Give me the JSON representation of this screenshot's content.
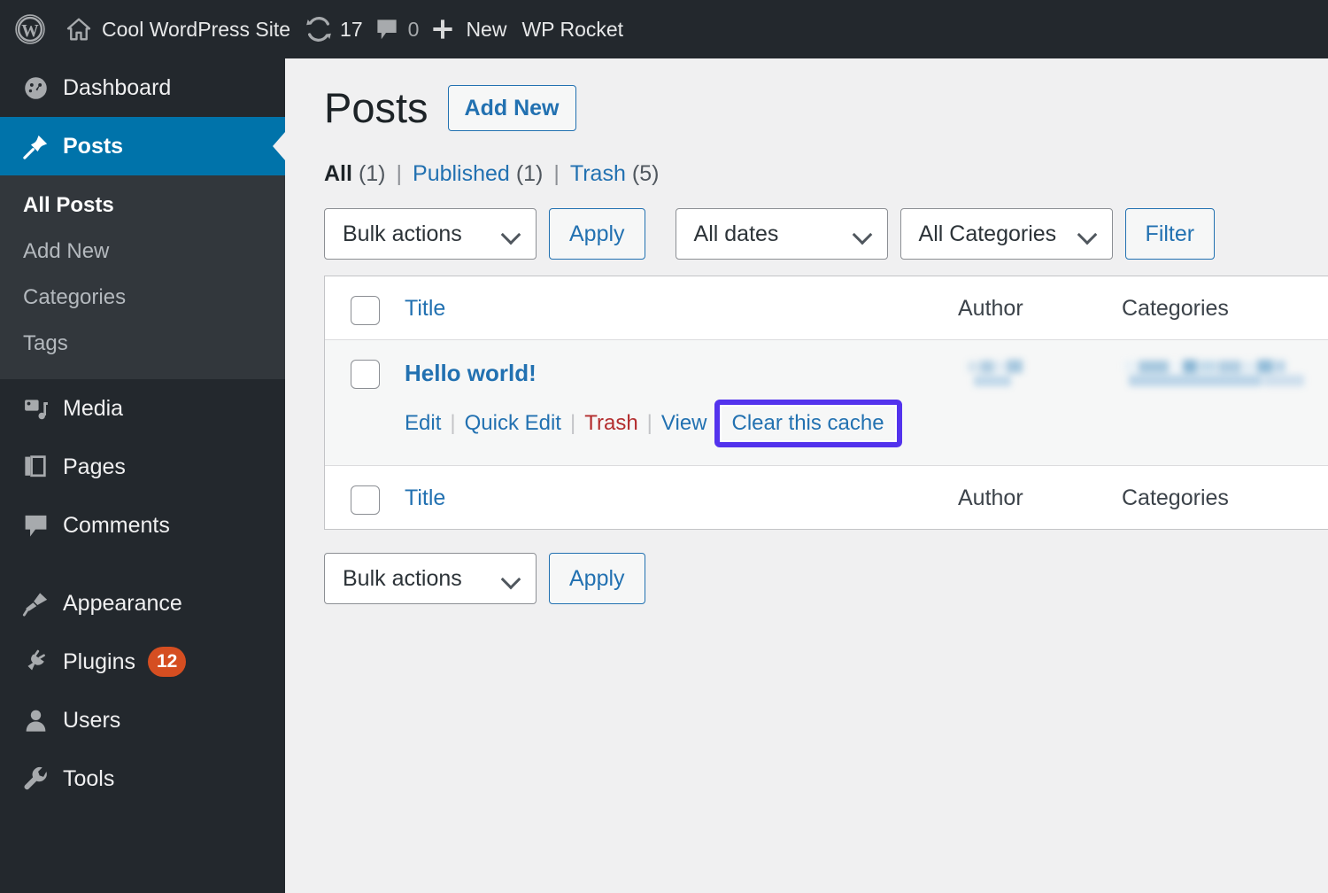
{
  "adminbar": {
    "wp_logo": "wordpress-logo",
    "site_name": "Cool WordPress Site",
    "updates_count": "17",
    "comments_count": "0",
    "new_label": "New",
    "wp_rocket_label": "WP Rocket"
  },
  "sidebar": {
    "items": [
      {
        "label": "Dashboard",
        "icon": "dashboard-icon",
        "current": false
      },
      {
        "label": "Posts",
        "icon": "pin-icon",
        "current": true
      },
      {
        "label": "Media",
        "icon": "media-icon",
        "current": false
      },
      {
        "label": "Pages",
        "icon": "pages-icon",
        "current": false
      },
      {
        "label": "Comments",
        "icon": "comments-icon",
        "current": false
      },
      {
        "label": "Appearance",
        "icon": "paintbrush-icon",
        "current": false
      },
      {
        "label": "Plugins",
        "icon": "plug-icon",
        "current": false,
        "badge": "12"
      },
      {
        "label": "Users",
        "icon": "users-icon",
        "current": false
      },
      {
        "label": "Tools",
        "icon": "wrench-icon",
        "current": false
      }
    ],
    "submenu": [
      {
        "label": "All Posts",
        "current": true
      },
      {
        "label": "Add New",
        "current": false
      },
      {
        "label": "Categories",
        "current": false
      },
      {
        "label": "Tags",
        "current": false
      }
    ]
  },
  "main": {
    "page_title": "Posts",
    "add_new_label": "Add New",
    "status_links": [
      {
        "label": "All",
        "count": "(1)",
        "current": true
      },
      {
        "label": "Published",
        "count": "(1)",
        "current": false
      },
      {
        "label": "Trash",
        "count": "(5)",
        "current": false
      }
    ],
    "separator": "|",
    "toolbar_top": {
      "bulk_actions_value": "Bulk actions",
      "apply_label": "Apply",
      "dates_value": "All dates",
      "categories_value": "All Categories",
      "filter_label": "Filter"
    },
    "toolbar_bottom": {
      "bulk_actions_value": "Bulk actions",
      "apply_label": "Apply"
    },
    "table": {
      "columns": {
        "title": "Title",
        "author": "Author",
        "categories": "Categories"
      },
      "rows": [
        {
          "title": "Hello world!",
          "author_redacted": true,
          "categories_redacted": true,
          "actions": {
            "edit": "Edit",
            "quick_edit": "Quick Edit",
            "trash": "Trash",
            "view": "View",
            "clear_cache": "Clear this cache"
          }
        }
      ]
    }
  },
  "colors": {
    "admin_bar": "#23282d",
    "sidebar": "#23282d",
    "submenu": "#32373c",
    "current_menu": "#0073aa",
    "link_blue": "#2271b1",
    "trash_red": "#b32d2e",
    "badge_orange": "#d54e21",
    "highlight_purple": "#5333ed",
    "content_bg": "#f0f0f1"
  }
}
